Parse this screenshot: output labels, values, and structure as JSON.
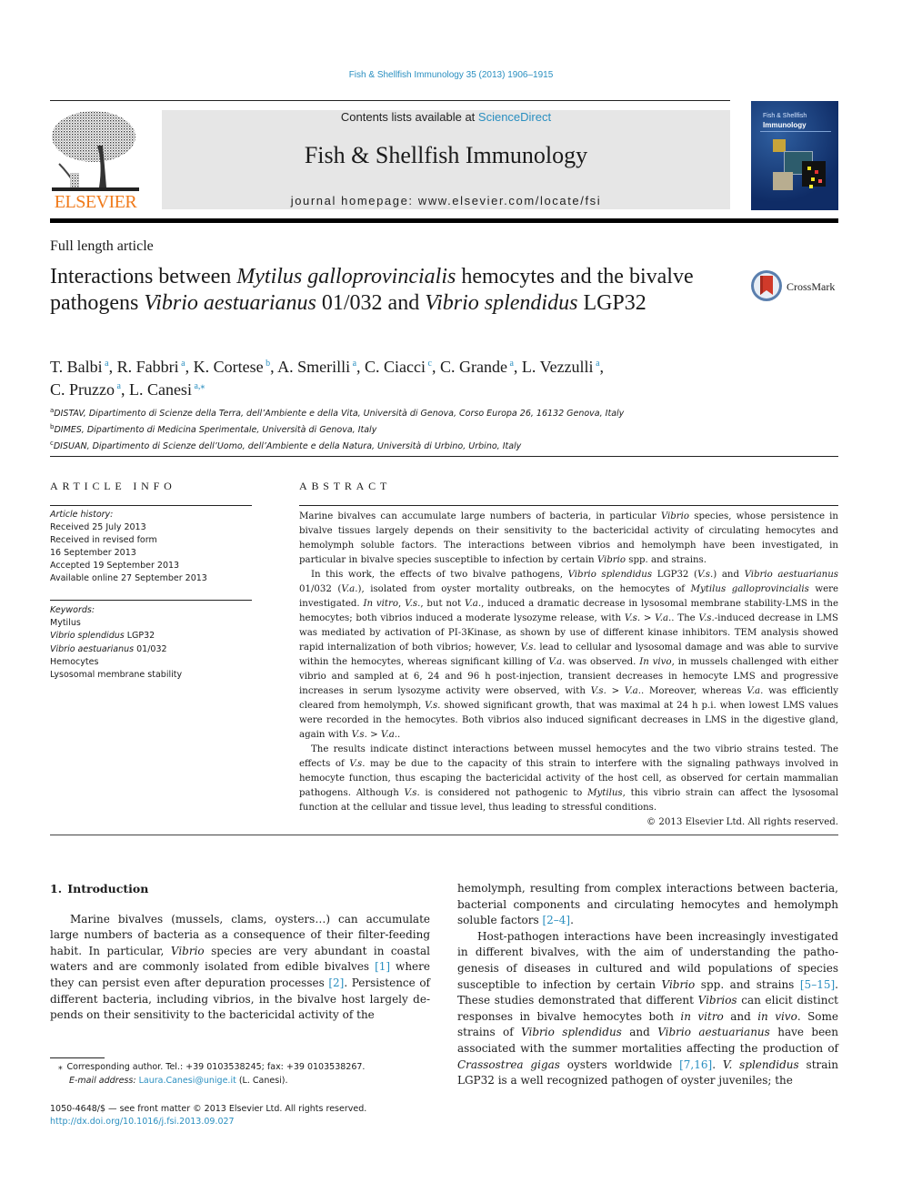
{
  "header": {
    "journal_ref": "Fish & Shellfish Immunology 35 (2013) 1906–1915",
    "contents_prefix": "Contents lists available at ",
    "contents_link": "ScienceDirect",
    "journal_title": "Fish & Shellfish Immunology",
    "homepage": "journal homepage: www.elsevier.com/locate/fsi",
    "publisher_logo": "ELSEVIER",
    "cover": {
      "line1": "Fish & Shellfish",
      "line2": "Immunology"
    },
    "colors": {
      "link": "#2a8fc0",
      "elsevier_orange": "#f07a1a",
      "banner_bg": "#e6e6e6"
    }
  },
  "article": {
    "type": "Full length article",
    "title_parts": [
      {
        "text": "Interactions between ",
        "italic": false
      },
      {
        "text": "Mytilus galloprovincialis",
        "italic": true
      },
      {
        "text": " hemocytes and the bivalve pathogens ",
        "italic": false
      },
      {
        "text": "Vibrio aestuarianus",
        "italic": true
      },
      {
        "text": " 01/032 and ",
        "italic": false
      },
      {
        "text": "Vibrio splendidus",
        "italic": true
      },
      {
        "text": " LGP32",
        "italic": false
      }
    ],
    "crossmark_label": "CrossMark",
    "authors": [
      {
        "name": "T. Balbi",
        "aff": "a"
      },
      {
        "name": "R. Fabbri",
        "aff": "a"
      },
      {
        "name": "K. Cortese",
        "aff": "b"
      },
      {
        "name": "A. Smerilli",
        "aff": "a"
      },
      {
        "name": "C. Ciacci",
        "aff": "c"
      },
      {
        "name": "C. Grande",
        "aff": "a"
      },
      {
        "name": "L. Vezzulli",
        "aff": "a"
      },
      {
        "name": "C. Pruzzo",
        "aff": "a"
      },
      {
        "name": "L. Canesi",
        "aff": "a,⁎"
      }
    ],
    "affiliations": [
      {
        "key": "a",
        "text": "DISTAV, Dipartimento di Scienze della Terra, dell’Ambiente e della Vita, Università di Genova, Corso Europa 26, 16132 Genova, Italy"
      },
      {
        "key": "b",
        "text": "DIMES, Dipartimento di Medicina Sperimentale, Università di Genova, Italy"
      },
      {
        "key": "c",
        "text": "DISUAN, Dipartimento di Scienze dell’Uomo, dell’Ambiente e della Natura, Università di Urbino, Urbino, Italy"
      }
    ]
  },
  "article_info": {
    "heading": "ARTICLE INFO",
    "history_label": "Article history:",
    "history": [
      "Received 25 July 2013",
      "Received in revised form",
      "16 September 2013",
      "Accepted 19 September 2013",
      "Available online 27 September 2013"
    ],
    "keywords_label": "Keywords:",
    "keywords": [
      {
        "parts": [
          {
            "text": "Mytilus",
            "italic": false
          }
        ]
      },
      {
        "parts": [
          {
            "text": "Vibrio splendidus",
            "italic": true
          },
          {
            "text": " LGP32",
            "italic": false
          }
        ]
      },
      {
        "parts": [
          {
            "text": "Vibrio aestuarianus",
            "italic": true
          },
          {
            "text": " 01/032",
            "italic": false
          }
        ]
      },
      {
        "parts": [
          {
            "text": "Hemocytes",
            "italic": false
          }
        ]
      },
      {
        "parts": [
          {
            "text": "Lysosomal membrane stability",
            "italic": false
          }
        ]
      }
    ]
  },
  "abstract": {
    "heading": "ABSTRACT",
    "paragraphs": [
      [
        {
          "text": "Marine bivalves can accumulate large numbers of bacteria, in particular ",
          "italic": false
        },
        {
          "text": "Vibrio",
          "italic": true
        },
        {
          "text": " species, whose persistence in bivalve tissues largely depends on their sensitivity to the bactericidal activity of circulating hemocytes and hemolymph soluble factors. The interactions between vibrios and hemolymph have been investi­gated, in particular in bivalve species susceptible to infection by certain ",
          "italic": false
        },
        {
          "text": "Vibrio",
          "italic": true
        },
        {
          "text": " spp. and strains.",
          "italic": false
        }
      ],
      [
        {
          "text": "In this work, the effects of two bivalve pathogens, ",
          "italic": false
        },
        {
          "text": "Vibrio splendidus",
          "italic": true
        },
        {
          "text": " LGP32 (",
          "italic": false
        },
        {
          "text": "V.s.",
          "italic": true
        },
        {
          "text": ") and ",
          "italic": false
        },
        {
          "text": "Vibrio aestuarianus",
          "italic": true
        },
        {
          "text": " 01/032 (",
          "italic": false
        },
        {
          "text": "V.a.",
          "italic": true
        },
        {
          "text": "), isolated from oyster mortality outbreaks, on the hemocytes of ",
          "italic": false
        },
        {
          "text": "Mytilus galloprovincialis",
          "italic": true
        },
        {
          "text": " were investigated. ",
          "italic": false
        },
        {
          "text": "In vitro",
          "italic": true
        },
        {
          "text": ", ",
          "italic": false
        },
        {
          "text": "V.s.",
          "italic": true
        },
        {
          "text": ", but not ",
          "italic": false
        },
        {
          "text": "V.a.",
          "italic": true
        },
        {
          "text": ", induced a dramatic decrease in lysosomal membrane stability-LMS in the hemocytes; both vibrios induced a moderate lysozyme release, with ",
          "italic": false
        },
        {
          "text": "V.s.",
          "italic": true
        },
        {
          "text": " > ",
          "italic": false
        },
        {
          "text": "V.a.",
          "italic": true
        },
        {
          "text": ". The ",
          "italic": false
        },
        {
          "text": "V.s.",
          "italic": true
        },
        {
          "text": "-induced decrease in LMS was mediated by activation of PI-3Kinase, as shown by use of different kinase inhibitors. TEM analysis showed rapid internalization of both vibrios; however, ",
          "italic": false
        },
        {
          "text": "V.s.",
          "italic": true
        },
        {
          "text": " lead to cellular and lysosomal damage and was able to survive within the hemocytes, whereas significant killing of ",
          "italic": false
        },
        {
          "text": "V.a.",
          "italic": true
        },
        {
          "text": " was observed. ",
          "italic": false
        },
        {
          "text": "In vivo",
          "italic": true
        },
        {
          "text": ", in mussels challenged with either vibrio and sampled at 6, 24 and 96 h post-injection, transient decreases in hemocyte LMS and progressive increases in serum lysozyme activity were observed, with ",
          "italic": false
        },
        {
          "text": "V.s.",
          "italic": true
        },
        {
          "text": " > ",
          "italic": false
        },
        {
          "text": "V.a.",
          "italic": true
        },
        {
          "text": ". Moreover, whereas ",
          "italic": false
        },
        {
          "text": "V.a.",
          "italic": true
        },
        {
          "text": " was efficiently cleared from hemolymph, ",
          "italic": false
        },
        {
          "text": "V.s.",
          "italic": true
        },
        {
          "text": " showed significant growth, that was maximal at 24 h p.i. when lowest LMS values were recorded in the hemocytes. Both vibrios also induced significant decreases in LMS in the digestive gland, again with ",
          "italic": false
        },
        {
          "text": "V.s.",
          "italic": true
        },
        {
          "text": " > ",
          "italic": false
        },
        {
          "text": "V.a.",
          "italic": true
        },
        {
          "text": ".",
          "italic": false
        }
      ],
      [
        {
          "text": "The results indicate distinct interactions between mussel hemocytes and the two vibrio strains tested. The effects of ",
          "italic": false
        },
        {
          "text": "V.s.",
          "italic": true
        },
        {
          "text": " may be due to the capacity of this strain to interfere with the signaling pathways involved in hemocyte function, thus escaping the bactericidal activity of the host cell, as observed for certain mammalian pathogens. Although ",
          "italic": false
        },
        {
          "text": "V.s.",
          "italic": true
        },
        {
          "text": " is considered not pathogenic to ",
          "italic": false
        },
        {
          "text": "Mytilus",
          "italic": true
        },
        {
          "text": ", this vibrio strain can affect the lysosomal function at the cellular and tissue level, thus leading to stressful conditions.",
          "italic": false
        }
      ]
    ],
    "copyright": "© 2013 Elsevier Ltd. All rights reserved."
  },
  "body": {
    "section_heading": "1. Introduction",
    "left_paragraphs": [
      [
        {
          "text": "Marine bivalves (mussels, clams, oysters…) can accumulate large numbers of bacteria as a consequence of their filter-feeding habit. In particular, ",
          "italic": false
        },
        {
          "text": "Vibrio",
          "italic": true
        },
        {
          "text": " species are very abundant in coastal waters and are commonly isolated from edible bivalves ",
          "italic": false
        },
        {
          "text": "[1]",
          "link": true
        },
        {
          "text": " where they can persist even after depuration processes ",
          "italic": false
        },
        {
          "text": "[2]",
          "link": true
        },
        {
          "text": ". Persistence of different bacteria, including vibrios, in the bivalve host largely de­pends on their sensitivity to the bactericidal activity of the",
          "italic": false
        }
      ]
    ],
    "right_paragraphs": [
      [
        {
          "text": "hemolymph, resulting from complex interactions between bacteria, bacterial components and circulating hemocytes and hemolymph soluble factors ",
          "italic": false
        },
        {
          "text": "[2–4]",
          "link": true
        },
        {
          "text": ".",
          "italic": false
        }
      ],
      [
        {
          "text": "Host-pathogen interactions have been increasingly investigated in different bivalves, with the aim of understanding the patho­genesis of diseases in cultured and wild populations of species susceptible to infection by certain ",
          "italic": false
        },
        {
          "text": "Vibrio",
          "italic": true
        },
        {
          "text": " spp. and strains ",
          "italic": false
        },
        {
          "text": "[5–15]",
          "link": true
        },
        {
          "text": ". These studies demonstrated that different ",
          "italic": false
        },
        {
          "text": "Vibrios",
          "italic": true
        },
        {
          "text": " can elicit distinct responses in bivalve hemocytes both ",
          "italic": false
        },
        {
          "text": "in vitro",
          "italic": true
        },
        {
          "text": " and ",
          "italic": false
        },
        {
          "text": "in vivo",
          "italic": true
        },
        {
          "text": ". Some strains of ",
          "italic": false
        },
        {
          "text": "Vibrio splendidus",
          "italic": true
        },
        {
          "text": " and ",
          "italic": false
        },
        {
          "text": "Vibrio aestuarianus",
          "italic": true
        },
        {
          "text": " have been associated with the summer mortalities affecting the production of ",
          "italic": false
        },
        {
          "text": "Crassostrea gigas",
          "italic": true
        },
        {
          "text": " oysters worldwide ",
          "italic": false
        },
        {
          "text": "[7,16]",
          "link": true
        },
        {
          "text": ". ",
          "italic": false
        },
        {
          "text": "V. splendidus",
          "italic": true
        },
        {
          "text": " strain LGP32 is a well recognized pathogen of oyster juveniles; the",
          "italic": false
        }
      ]
    ]
  },
  "footnotes": {
    "corresponding": "⁎ Corresponding author. Tel.: +39 0103538245; fax: +39 0103538267.",
    "email_label": "E-mail address:",
    "email": "Laura.Canesi@unige.it",
    "email_suffix": " (L. Canesi).",
    "front_matter": "1050-4648/$ — see front matter © 2013 Elsevier Ltd. All rights reserved.",
    "doi": "http://dx.doi.org/10.1016/j.fsi.2013.09.027"
  }
}
